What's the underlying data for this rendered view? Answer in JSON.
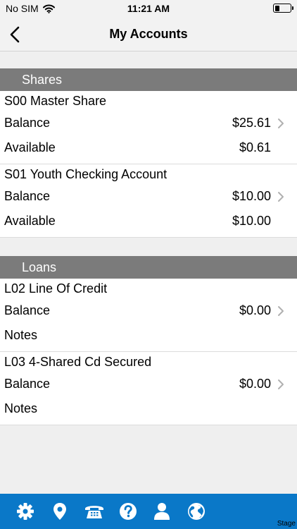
{
  "status_bar": {
    "carrier": "No SIM",
    "time": "11:21 AM",
    "battery_level": 0.3
  },
  "nav": {
    "title": "My Accounts"
  },
  "sections": [
    {
      "title": "Shares",
      "accounts": [
        {
          "name": "S00 Master Share",
          "row1_label": "Balance",
          "row1_value": "$25.61",
          "row2_label": "Available",
          "row2_value": "$0.61"
        },
        {
          "name": "S01 Youth Checking Account",
          "row1_label": "Balance",
          "row1_value": "$10.00",
          "row2_label": "Available",
          "row2_value": "$10.00"
        }
      ]
    },
    {
      "title": "Loans",
      "accounts": [
        {
          "name": "L02 Line Of Credit",
          "row1_label": "Balance",
          "row1_value": "$0.00",
          "row2_label": "Notes",
          "row2_value": ""
        },
        {
          "name": "L03 4-Shared Cd Secured",
          "row1_label": "Balance",
          "row1_value": "$0.00",
          "row2_label": "Notes",
          "row2_value": ""
        }
      ]
    }
  ],
  "tab_bar": {
    "color": "#0a78c8",
    "icons": [
      "gear-icon",
      "location-pin-icon",
      "phone-icon",
      "help-icon",
      "person-icon",
      "globe-icon"
    ],
    "badge_text": "Stage"
  }
}
